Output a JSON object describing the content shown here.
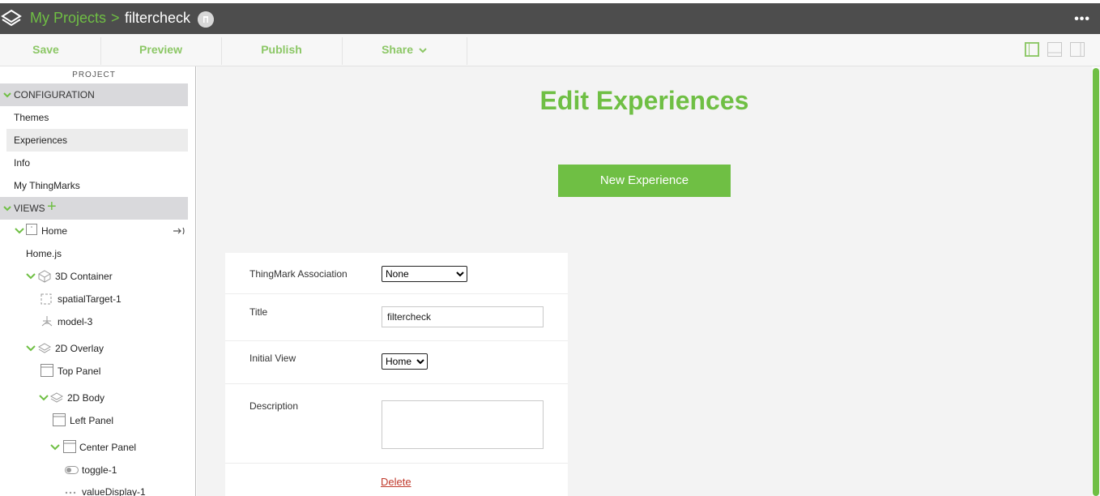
{
  "header": {
    "breadcrumb_root": "My Projects",
    "breadcrumb_sep": ">",
    "project_name": "filtercheck",
    "more_icon": "ellipsis-icon"
  },
  "toolbar": {
    "save": "Save",
    "preview": "Preview",
    "publish": "Publish",
    "share": "Share",
    "share_chevron": "⌄",
    "accent": "#8cc766"
  },
  "sidebar": {
    "project_label": "PROJECT",
    "configuration_label": "CONFIGURATION",
    "config_items": [
      "Themes",
      "Experiences",
      "Info",
      "My ThingMarks"
    ],
    "views_label": "VIEWS",
    "views_add": "+",
    "tree": {
      "home": "Home",
      "home_js": "Home.js",
      "container_3d": "3D Container",
      "spatial_target": "spatialTarget-1",
      "model": "model-3",
      "overlay_2d": "2D Overlay",
      "top_panel": "Top Panel",
      "body_2d": "2D Body",
      "left_panel": "Left Panel",
      "center_panel": "Center Panel",
      "toggle": "toggle-1",
      "value_display": "valueDisplay-1"
    }
  },
  "main": {
    "title": "Edit Experiences",
    "new_button": "New Experience",
    "form": {
      "thingmark_label": "ThingMark Association",
      "thingmark_value": "None",
      "title_label": "Title",
      "title_value": "filtercheck",
      "initial_view_label": "Initial View",
      "initial_view_value": "Home",
      "description_label": "Description",
      "description_value": "",
      "delete_label": "Delete"
    }
  },
  "colors": {
    "brand_green": "#6fbf44",
    "topbar_bg": "#4d4d4d",
    "delete_red": "#c0392b"
  }
}
